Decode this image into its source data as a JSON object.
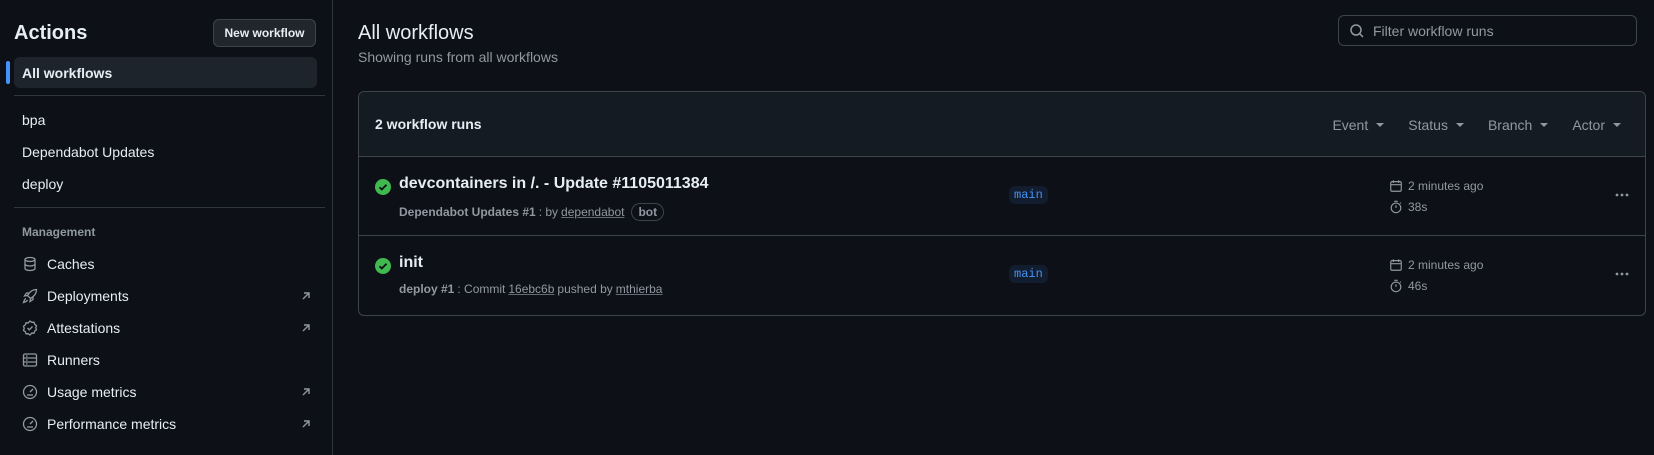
{
  "sidebar": {
    "title": "Actions",
    "new_workflow": "New workflow",
    "all_workflows": "All workflows",
    "workflows": [
      "bpa",
      "Dependabot Updates",
      "deploy"
    ],
    "management_heading": "Management",
    "management": [
      {
        "label": "Caches",
        "icon": "database-icon",
        "external": false
      },
      {
        "label": "Deployments",
        "icon": "rocket-icon",
        "external": true
      },
      {
        "label": "Attestations",
        "icon": "verified-icon",
        "external": true
      },
      {
        "label": "Runners",
        "icon": "server-icon",
        "external": false
      },
      {
        "label": "Usage metrics",
        "icon": "meter-icon",
        "external": true
      },
      {
        "label": "Performance metrics",
        "icon": "meter-icon",
        "external": true
      }
    ]
  },
  "main": {
    "title": "All workflows",
    "subtitle": "Showing runs from all workflows",
    "filter_placeholder": "Filter workflow runs",
    "runs_count": "2 workflow runs",
    "filters": [
      "Event",
      "Status",
      "Branch",
      "Actor"
    ],
    "runs": [
      {
        "title": "devcontainers in /. - Update #1105011384",
        "workflow": "Dependabot Updates #1",
        "sep": ": by",
        "actor": "dependabot",
        "badge": "bot",
        "branch": "main",
        "time": "2 minutes ago",
        "duration": "38s",
        "status": "success"
      },
      {
        "title": "init",
        "workflow": "deploy #1",
        "sep": ": Commit",
        "commit": "16ebc6b",
        "pushed": "pushed by",
        "actor": "mthierba",
        "branch": "main",
        "time": "2 minutes ago",
        "duration": "46s",
        "status": "success"
      }
    ]
  },
  "colors": {
    "background": "#0d1117",
    "accent": "#4493f8",
    "success": "#3fb950",
    "muted": "#9198a1",
    "border": "#3d444d"
  }
}
